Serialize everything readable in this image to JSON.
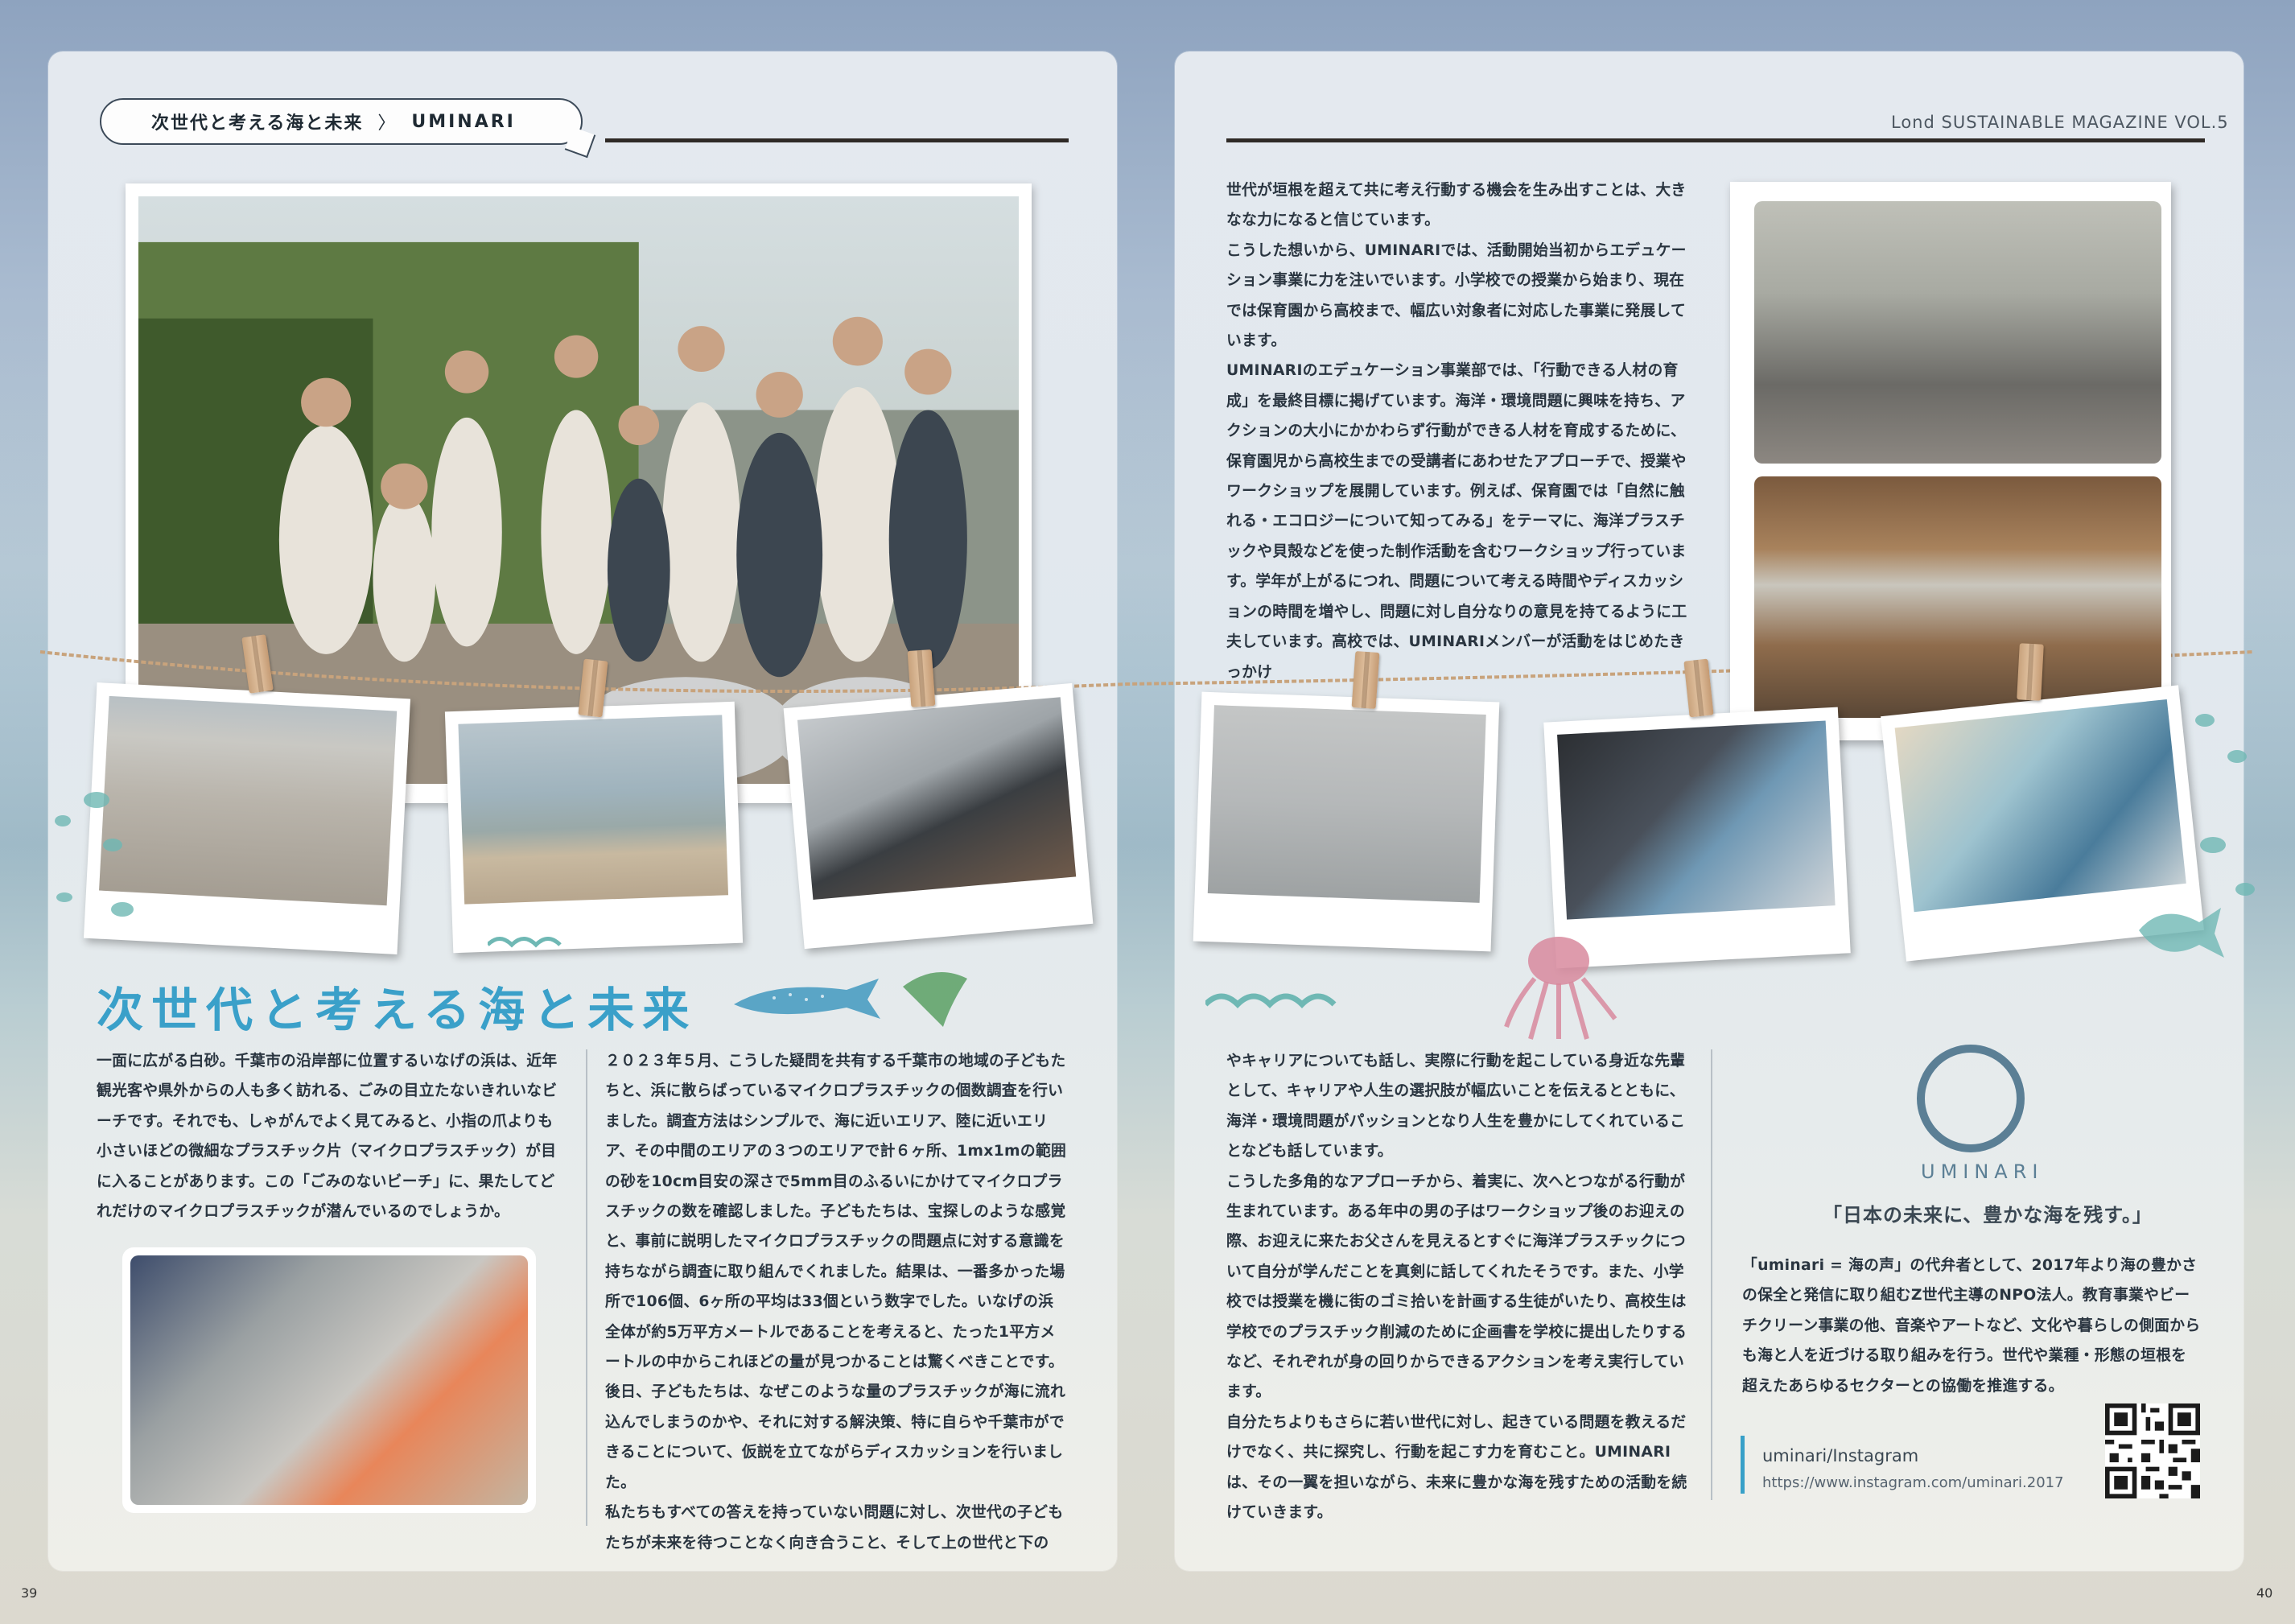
{
  "magazine_title": "Lond SUSTAINABLE MAGAZINE VOL.5",
  "breadcrumb": {
    "section": "次世代と考える海と未来",
    "separator": "〉",
    "current": "UMINARI"
  },
  "heading": "次世代と考える海と未来",
  "left_col1": "一面に広がる白砂。千葉市の沿岸部に位置するいなげの浜は、近年観光客や県外からの人も多く訪れる、ごみの目立たないきれいなビーチです。それでも、しゃがんでよく見てみると、小指の爪よりも小さいほどの微細なプラスチック片（マイクロプラスチック）が目に入ることがあります。この「ごみのないビーチ」に、果たしてどれだけのマイクロプラスチックが潜んでいるのでしょうか。",
  "left_col2_p1": "２０２３年５月、こうした疑問を共有する千葉市の地域の子どもたちと、浜に散らばっているマイクロプラスチックの個数調査を行いました。調査方法はシンプルで、海に近いエリア、陸に近いエリア、その中間のエリアの３つのエリアで計６ヶ所、1mx1mの範囲の砂を10cm目安の深さで5mm目のふるいにかけてマイクロプラスチックの数を確認しました。子どもたちは、宝探しのような感覚と、事前に説明したマイクロプラスチックの問題点に対する意識を持ちながら調査に取り組んでくれました。結果は、一番多かった場所で106個、6ヶ所の平均は33個という数字でした。いなげの浜全体が約5万平方メートルであることを考えると、たった1平方メートルの中からこれほどの量が見つかることは驚くべきことです。",
  "left_col2_p2": "後日、子どもたちは、なぜこのような量のプラスチックが海に流れ込んでしまうのかや、それに対する解決策、特に自らや千葉市ができることについて、仮説を立てながらディスカッションを行いました。",
  "left_col2_p3": "私たちもすべての答えを持っていない問題に対し、次世代の子どもたちが未来を待つことなく向き合うこと、そして上の世代と下の",
  "right_top_p1": "世代が垣根を超えて共に考え行動する機会を生み出すことは、大きなな力になると信じています。",
  "right_top_p2": "こうした想いから、UMINARIでは、活動開始当初からエデュケーション事業に力を注いでいます。小学校での授業から始まり、現在では保育園から高校まで、幅広い対象者に対応した事業に発展しています。",
  "right_top_p3": "UMINARIのエデュケーション事業部では、「行動できる人材の育成」を最終目標に掲げています。海洋・環境問題に興味を持ち、アクションの大小にかかわらず行動ができる人材を育成するために、保育園児から高校生までの受講者にあわせたアプローチで、授業やワークショップを展開しています。例えば、保育園では「自然に触れる・エコロジーについて知ってみる」をテーマに、海洋プラスチックや貝殻などを使った制作活動を含むワークショップ行っています。学年が上がるにつれ、問題について考える時間やディスカッションの時間を増やし、問題に対し自分なりの意見を持てるように工夫しています。高校では、UMINARIメンバーが活動をはじめたきっかけ",
  "right_bottom_p1": "やキャリアについても話し、実際に行動を起こしている身近な先輩として、キャリアや人生の選択肢が幅広いことを伝えるとともに、海洋・環境問題がパッションとなり人生を豊かにしてくれていることなども話しています。",
  "right_bottom_p2": "こうした多角的なアプローチから、着実に、次へとつながる行動が生まれています。ある年中の男の子はワークショップ後のお迎えの際、お迎えに来たお父さんを見えるとすぐに海洋プラスチックについて自分が学んだことを真剣に話してくれたそうです。また、小学校では授業を機に街のゴミ拾いを計画する生徒がいたり、高校生は学校でのプラスチック削減のために企画書を学校に提出したりするなど、それぞれが身の回りからできるアクションを考え実行しています。",
  "right_bottom_p3": "自分たちよりもさらに若い世代に対し、起きている問題を教えるだけでなく、共に探究し、行動を起こす力を育むこと。UMINARIは、その一翼を担いながら、未来に豊かな海を残すための活動を続けていきます。",
  "org": {
    "logo_text": "UMINARI",
    "tagline": "「日本の未来に、豊かな海を残す。」",
    "description": "「uminari = 海の声」の代弁者として、2017年より海の豊かさの保全と発信に取り組むZ世代主導のNPO法人。教育事業やビーチクリーン事業の他、音楽やアートなど、文化や暮らしの側面からも海と人を近づける取り組みを行う。世代や業種・形態の垣根を超えたあらゆるセクターとの協働を推進する。",
    "instagram_label": "uminari/Instagram",
    "instagram_url": "https://www.instagram.com/uminari.2017"
  },
  "page_numbers": {
    "left": "39",
    "right": "40"
  },
  "colors": {
    "accent": "#3aa0c9",
    "text": "#2a3540",
    "logo": "#5b7f95"
  }
}
